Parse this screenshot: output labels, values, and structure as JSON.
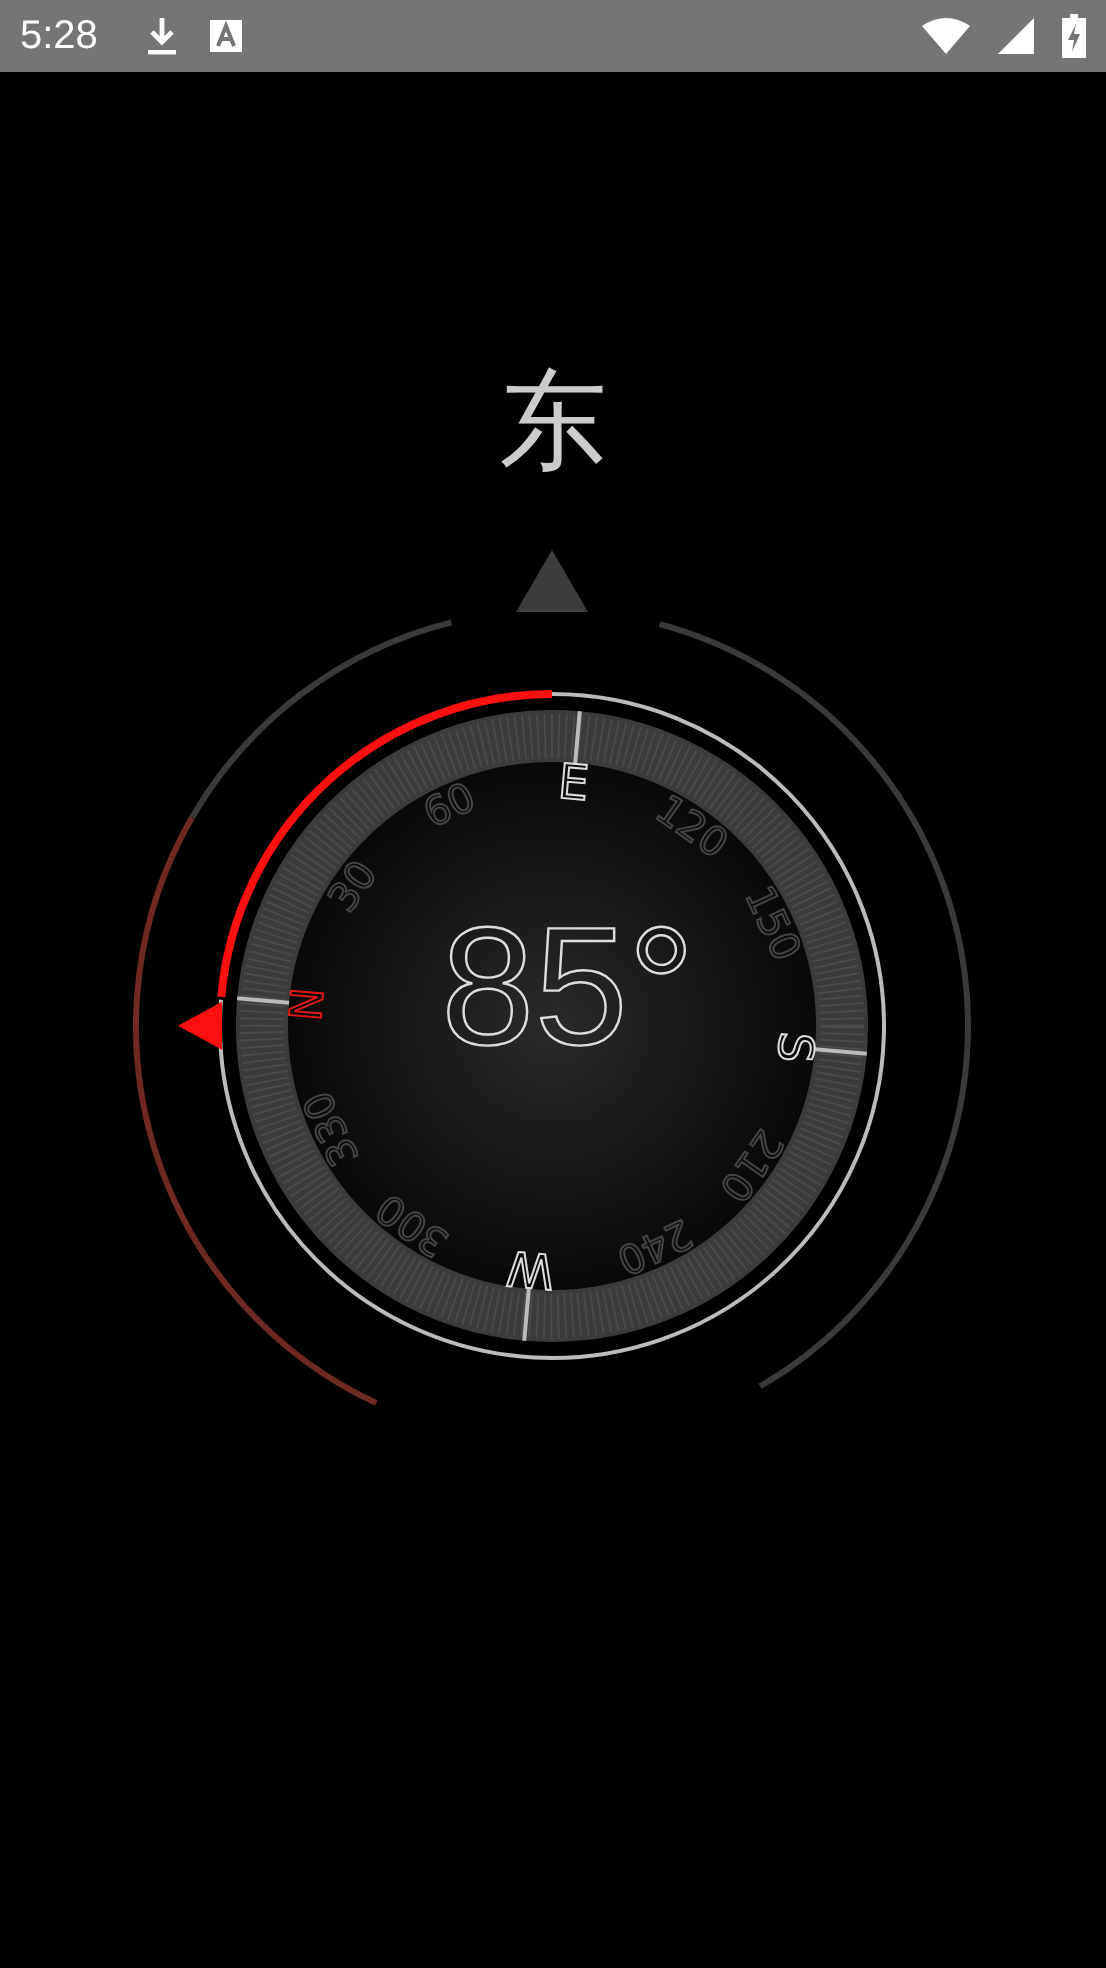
{
  "status_bar": {
    "time": "5:28"
  },
  "direction": "东",
  "compass": {
    "heading": "85°",
    "level": 0.236,
    "labels": [
      {
        "text": "N",
        "kind": "north"
      },
      {
        "text": "30",
        "kind": "degree"
      },
      {
        "text": "60",
        "kind": "degree"
      },
      {
        "text": "E",
        "kind": "cardinal"
      },
      {
        "text": "120",
        "kind": "degree"
      },
      {
        "text": "150",
        "kind": "degree"
      },
      {
        "text": "S",
        "kind": "cardinal"
      },
      {
        "text": "210",
        "kind": "degree"
      },
      {
        "text": "240",
        "kind": "degree"
      },
      {
        "text": "W",
        "kind": "cardinal"
      },
      {
        "text": "300",
        "kind": "degree"
      },
      {
        "text": "330",
        "kind": "degree"
      }
    ]
  }
}
